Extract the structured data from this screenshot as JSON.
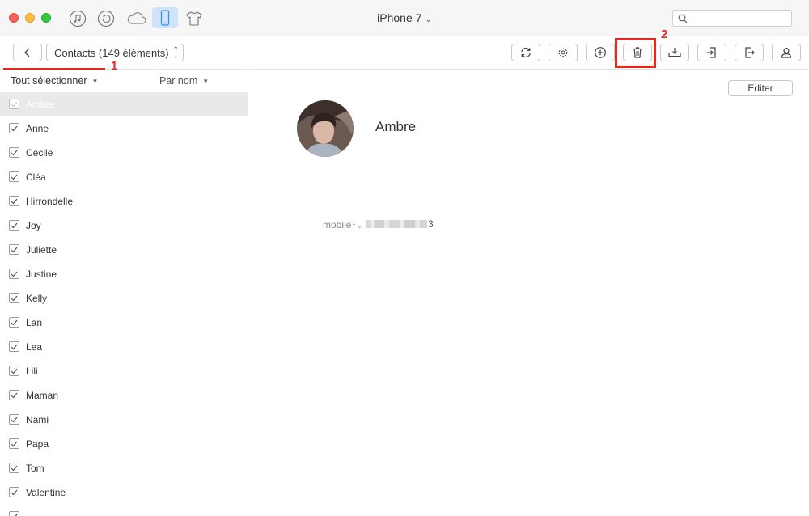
{
  "titlebar": {
    "device_name": "iPhone 7",
    "search_placeholder": "",
    "icons": [
      "music-icon",
      "restore-icon",
      "cloud-icon",
      "iphone-icon",
      "tshirt-icon"
    ]
  },
  "toolbar": {
    "category_select": "Contacts (149 éléments)",
    "buttons": [
      "refresh-icon",
      "settings-icon",
      "add-icon",
      "delete-icon",
      "export-to-device-icon",
      "import-icon",
      "export-icon",
      "contact-icon"
    ]
  },
  "annotations": {
    "one": "1",
    "two": "2",
    "color": "#e8261a"
  },
  "list_header": {
    "select_all": "Tout sélectionner",
    "sort": "Par nom"
  },
  "contacts": [
    {
      "name": "Ambre",
      "checked": true,
      "selected": true
    },
    {
      "name": "Anne",
      "checked": true
    },
    {
      "name": "Cécile",
      "checked": true
    },
    {
      "name": "Cléa",
      "checked": true
    },
    {
      "name": "Hirrondelle",
      "checked": true
    },
    {
      "name": "Joy",
      "checked": true
    },
    {
      "name": "Juliette",
      "checked": true
    },
    {
      "name": "Justine",
      "checked": true
    },
    {
      "name": "Kelly",
      "checked": true
    },
    {
      "name": "Lan",
      "checked": true
    },
    {
      "name": "Lea",
      "checked": true
    },
    {
      "name": "Lili",
      "checked": true
    },
    {
      "name": "Maman",
      "checked": true
    },
    {
      "name": "Nami",
      "checked": true
    },
    {
      "name": "Papa",
      "checked": true
    },
    {
      "name": "Tom",
      "checked": true
    },
    {
      "name": "Valentine",
      "checked": true
    },
    {
      "name": "",
      "checked": true
    }
  ],
  "detail": {
    "edit_button": "Editer",
    "name": "Ambre",
    "phone_label": "mobile",
    "phone_value_visible_suffix": "3"
  },
  "colors": {
    "active_tab_bg": "#cfe4fb",
    "selected_row_bg": "#e9e9e9",
    "highlight": "#e8261a"
  }
}
